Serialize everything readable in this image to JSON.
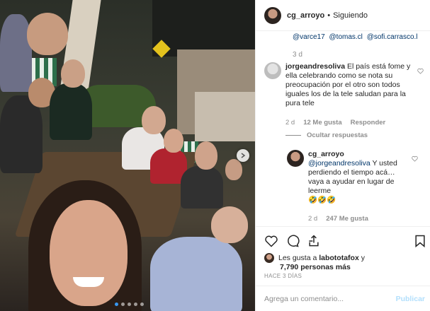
{
  "header": {
    "username": "cg_arroyo",
    "separator": "•",
    "follow_status": "Siguiendo"
  },
  "comments_panel": {
    "mentions": [
      "@varce17",
      "@tomas.cl",
      "@sofi.carrasco.l"
    ],
    "mentions_age": "3 d",
    "comment": {
      "username": "jorgeandresoliva",
      "text": "El país está fome y ella celebrando como se nota su preocupación por el otro son todos iguales los de la tele saludan para la pura tele",
      "age": "2 d",
      "likes": "12 Me gusta",
      "reply": "Responder",
      "hide_replies": "Ocultar respuestas"
    },
    "reply": {
      "username": "cg_arroyo",
      "mention": "@jorgeandresoliva",
      "text": " Y usted perdiendo el tiempo acá… vaya a ayudar en lugar de leerme",
      "emojis": "🤣🤣🤣",
      "age": "2 d",
      "likes": "247 Me gusta"
    }
  },
  "likes": {
    "prefix": "Les gusta a",
    "user": "labototafox",
    "middle": " y",
    "others": "7,790 personas más"
  },
  "post_age": "HACE 3 DÍAS",
  "add_comment": {
    "placeholder": "Agrega un comentario...",
    "post_label": "Publicar"
  },
  "colors": {
    "link": "#003569",
    "muted": "#8e8e8e",
    "publish_disabled": "#b2dffc",
    "carousel_active": "#3897f0"
  },
  "carousel": {
    "slides": 5,
    "active_index": 0
  }
}
